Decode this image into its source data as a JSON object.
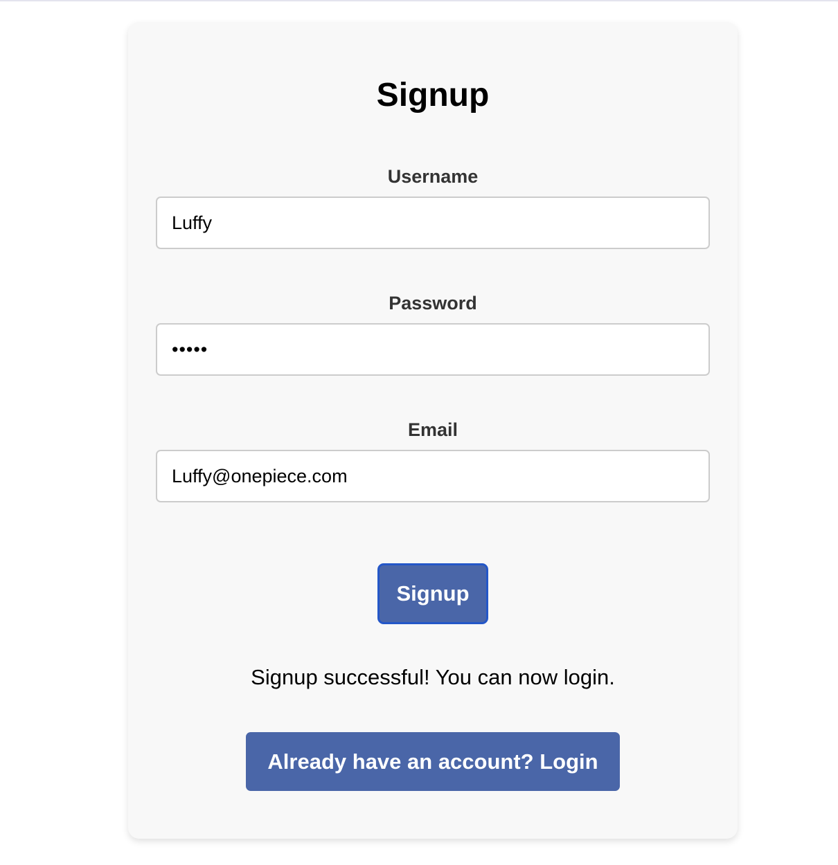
{
  "form": {
    "title": "Signup",
    "username": {
      "label": "Username",
      "value": "Luffy"
    },
    "password": {
      "label": "Password",
      "value": "•••••"
    },
    "email": {
      "label": "Email",
      "value": "Luffy@onepiece.com"
    },
    "submit_label": "Signup",
    "status_message": "Signup successful! You can now login.",
    "login_link_label": "Already have an account? Login"
  },
  "colors": {
    "card_background": "#f8f8f8",
    "button_background": "#4a66a8",
    "button_focus_border": "#2457c8",
    "label_text": "#333333"
  }
}
